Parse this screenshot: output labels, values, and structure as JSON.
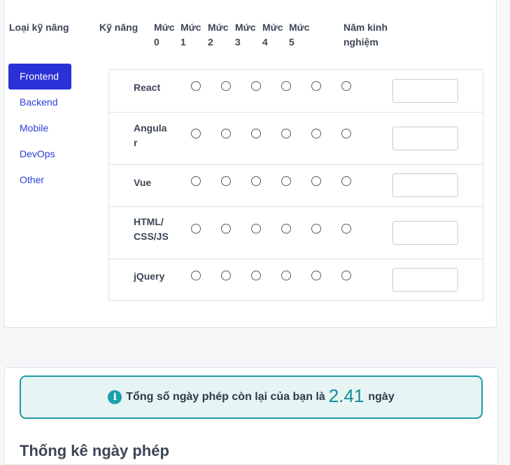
{
  "headers": {
    "category": "Loại kỹ năng",
    "skill": "Kỹ năng",
    "levels": [
      "Mức 0",
      "Mức 1",
      "Mức 2",
      "Mức 3",
      "Mức 4",
      "Mức 5"
    ],
    "years": "Năm kinh nghiệm"
  },
  "categories": [
    "Frontend",
    "Backend",
    "Mobile",
    "DevOps",
    "Other"
  ],
  "active_category": "Frontend",
  "skills": [
    {
      "name": "React",
      "years": ""
    },
    {
      "name": "Angular",
      "years": ""
    },
    {
      "name": "Vue",
      "years": ""
    },
    {
      "name": "HTML/CSS/JS",
      "years": ""
    },
    {
      "name": "jQuery",
      "years": ""
    }
  ],
  "leave": {
    "prefix": "Tổng số ngày phép còn lại của bạn là",
    "value": "2.41",
    "suffix": "ngày"
  },
  "stats_title": "Thống kê ngày phép",
  "icons": {
    "info": "info-icon"
  },
  "colors": {
    "accent": "#2a31d6",
    "link": "#2c3ed7",
    "info": "#1aa0ac",
    "info_bg": "#e7f4f4"
  }
}
